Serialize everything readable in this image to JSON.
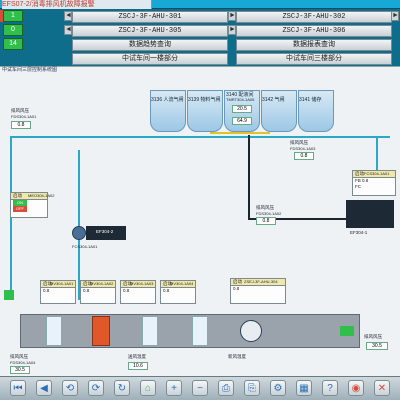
{
  "header": {
    "alarm_text": "EFS07-2/消毒排风机故障报警",
    "left_values": [
      "1",
      "0",
      "14"
    ]
  },
  "nav": {
    "row1": [
      "ZSCJ-3F-AHU-301",
      "ZSCJ-3F-AHU-302"
    ],
    "row2": [
      "ZSCJ-3F-AHU-305",
      "ZSCJ-3F-AHU-306"
    ],
    "row3": [
      "数据趋势查询",
      "数据报表查询"
    ],
    "row4": [
      "中试车间一楼部分",
      "中试车间三楼部分"
    ]
  },
  "panel": {
    "title": "中试车间三层控制系统图",
    "tanks": [
      {
        "code": "3136",
        "name": "人流气闸"
      },
      {
        "code": "3139",
        "name": "物料气闸"
      },
      {
        "code": "3140",
        "name": "配液间"
      },
      {
        "code": "3142",
        "name": "气闸"
      },
      {
        "code": "3141",
        "name": "储存"
      }
    ],
    "tank_sensor": {
      "tag": "TMRT304-1A05",
      "v1": "20.5",
      "v2": "64.9"
    },
    "left_flow": {
      "label": "排风风压",
      "tag": "FDS304-1A01",
      "value": "0.8"
    },
    "left_ctrl": {
      "title": "启动",
      "tag": "MEO304-1A02",
      "on": "ON",
      "off": "OFF"
    },
    "fans": [
      {
        "name": "EF304-2",
        "tag": "FCS304-1A01"
      },
      {
        "name": "EF304-1",
        "tag": "FCS304-1A01"
      }
    ],
    "mid_sensor": {
      "label": "排风风压",
      "tag": "FDS304-1A02",
      "value": "0.8"
    },
    "right_sensor": {
      "label": "排风风压",
      "tag": "FDS304-1A03",
      "value": "0.8"
    },
    "right_ctrl": {
      "title": "启动",
      "tag": "FCS304-1A01",
      "rows": [
        "FB",
        "FC"
      ],
      "values": [
        "0.8",
        ""
      ]
    },
    "valves": [
      {
        "title": "启动",
        "tag": "MV304-1A01",
        "fb": "0.8",
        "fc": ""
      },
      {
        "title": "启动",
        "tag": "MV304-1A02",
        "fb": "0.8",
        "fc": ""
      },
      {
        "title": "启动",
        "tag": "MV304-1A03",
        "fb": "0.8",
        "fc": ""
      },
      {
        "title": "启动",
        "tag": "MV304-1A04",
        "fb": "0.8",
        "fc": ""
      },
      {
        "title": "启动",
        "tag": "ZSEJ-3F-AHU-304",
        "fb": "0.8",
        "fc": ""
      }
    ],
    "bottom_labels": [
      "排风风压",
      "FDS304-1A04",
      "30.5",
      "送风温度",
      "10.6",
      "新风温度"
    ],
    "bottom_right": {
      "label": "排风风压",
      "value": "30.5"
    }
  },
  "toolbar": {
    "icons": [
      "prev-icon",
      "back-icon",
      "nav-left-icon",
      "nav-right-icon",
      "refresh-icon",
      "home-icon",
      "zoom-in-icon",
      "zoom-out-icon",
      "print-icon",
      "save-icon",
      "settings-icon",
      "chart-icon",
      "help-icon",
      "alarm-icon",
      "close-icon"
    ]
  }
}
